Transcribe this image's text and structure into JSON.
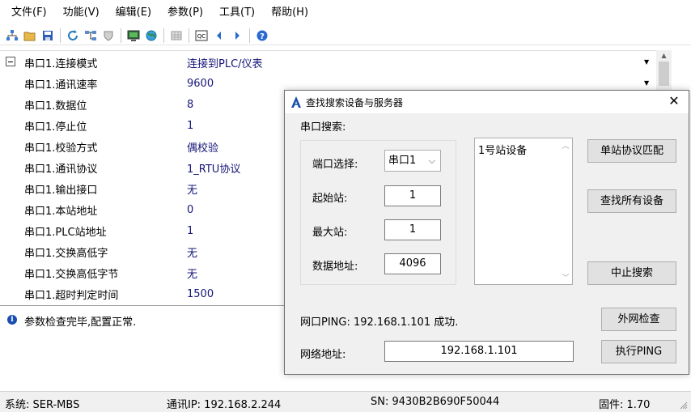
{
  "menu": [
    "文件(F)",
    "功能(V)",
    "编辑(E)",
    "参数(P)",
    "工具(T)",
    "帮助(H)"
  ],
  "grid": {
    "rows": [
      {
        "name": "串口1.连接模式",
        "value": "连接到PLC/仪表"
      },
      {
        "name": "串口1.通讯速率",
        "value": "9600"
      },
      {
        "name": "串口1.数据位",
        "value": "8"
      },
      {
        "name": "串口1.停止位",
        "value": "1"
      },
      {
        "name": "串口1.校验方式",
        "value": "偶校验"
      },
      {
        "name": "串口1.通讯协议",
        "value": "1_RTU协议"
      },
      {
        "name": "串口1.输出接口",
        "value": "无"
      },
      {
        "name": "串口1.本站地址",
        "value": "0"
      },
      {
        "name": "串口1.PLC站地址",
        "value": "1"
      },
      {
        "name": "串口1.交换高低字",
        "value": "无"
      },
      {
        "name": "串口1.交换高低字节",
        "value": "无"
      },
      {
        "name": "串口1.超时判定时间",
        "value": "1500"
      }
    ]
  },
  "info": {
    "message": "参数检查完毕,配置正常."
  },
  "status": {
    "system": "系统:  SER-MBS",
    "ip": "通讯IP:  192.168.2.244",
    "sn": "SN:  9430B2B690F50044",
    "firmware": "固件:  1.70"
  },
  "dialog": {
    "title": "查找搜索设备与服务器",
    "serial_search_label": "串口搜索:",
    "port_label": "端口选择:",
    "port_value": "串口1",
    "start_label": "起始站:",
    "start_value": "1",
    "max_label": "最大站:",
    "max_value": "1",
    "addr_label": "数据地址:",
    "addr_value": "4096",
    "list_items": [
      "1号站设备"
    ],
    "btn_single": "单站协议匹配",
    "btn_find_all": "查找所有设备",
    "btn_stop": "中止搜索",
    "ping_status": "网口PING:  192.168.1.101  成功.",
    "btn_external": "外网检查",
    "net_label": "网络地址:",
    "net_value": "192.168.1.101",
    "btn_ping": "执行PING"
  }
}
